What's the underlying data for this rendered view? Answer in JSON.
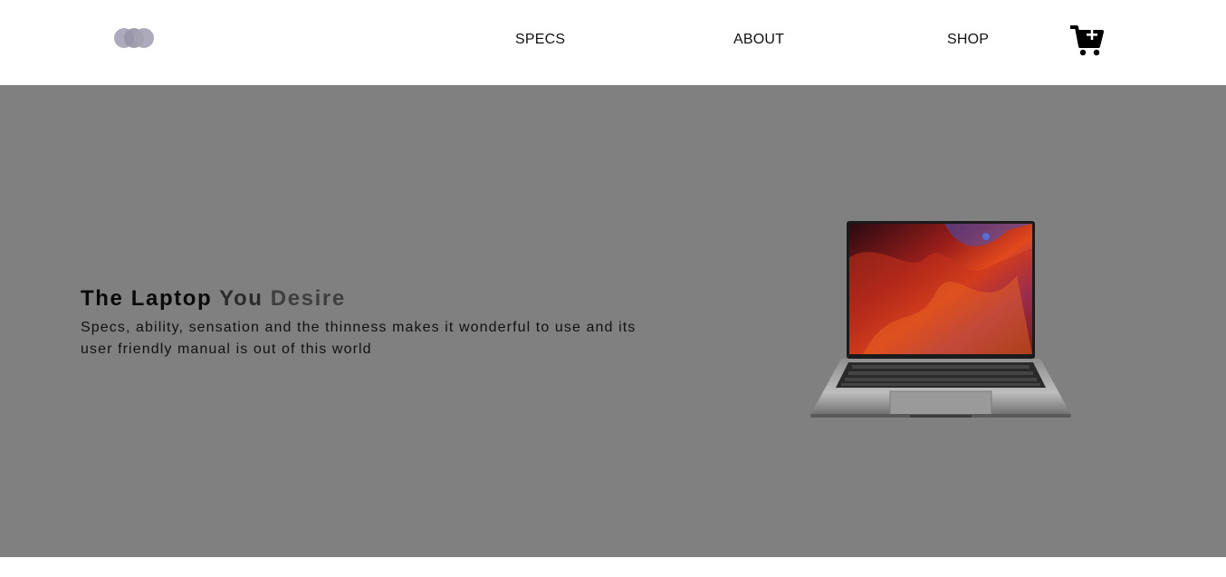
{
  "nav": {
    "logo_icon": "overlapping-circles-logo",
    "links": {
      "specs": "SPECS",
      "about": "ABOUT",
      "shop": "SHOP"
    },
    "cart_icon": "cart-plus-icon"
  },
  "hero": {
    "title_part1": "The Laptop ",
    "title_part2": "You ",
    "title_part3": "Desire",
    "description": "Specs, ability, sensation and the thinness makes it wonderful to use and its user friendly manual is out of this world",
    "image_icon": "laptop-image",
    "background_color": "#808080"
  }
}
